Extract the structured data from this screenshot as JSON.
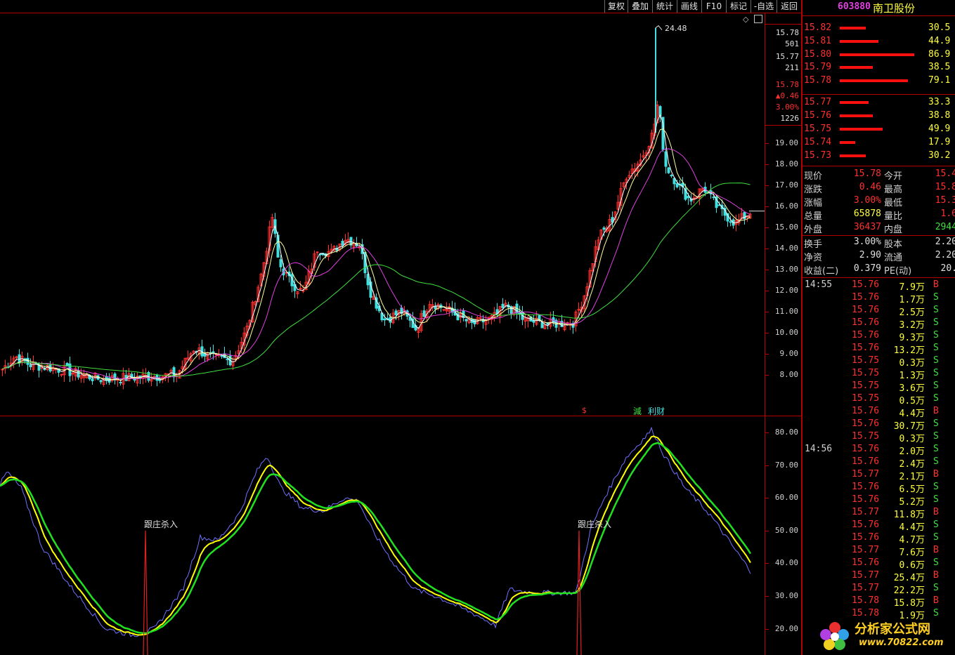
{
  "toolbar": {
    "buttons": [
      "复权",
      "叠加",
      "统计",
      "画线",
      "F10",
      "标记",
      "-自选",
      "返回"
    ]
  },
  "stock": {
    "code": "603880",
    "name": "南卫股份"
  },
  "price_axis": {
    "ticks": [
      "19.00",
      "18.00",
      "17.00",
      "16.00",
      "15.00",
      "14.00",
      "13.00",
      "12.00",
      "11.00",
      "10.00",
      "9.00",
      "8.00"
    ]
  },
  "mini_info": {
    "p1": "15.78",
    "v1": "501",
    "p2": "15.77",
    "v2": "211",
    "last": "15.78",
    "chg": "▲0.46",
    "pct": "3.00%",
    "vol": "1226"
  },
  "peak_label": "24.48",
  "markers": {
    "s": "$",
    "jian": "減",
    "cai": "利财"
  },
  "indicator_axis": {
    "ticks": [
      "80.00",
      "70.00",
      "60.00",
      "50.00",
      "40.00",
      "30.00",
      "20.00"
    ]
  },
  "signals": [
    {
      "label": "跟庄杀入"
    },
    {
      "label": "跟庄杀入"
    }
  ],
  "sell_orders": [
    {
      "price": "15.82",
      "vol": "30.5"
    },
    {
      "price": "15.81",
      "vol": "44.9"
    },
    {
      "price": "15.80",
      "vol": "86.9"
    },
    {
      "price": "15.79",
      "vol": "38.5"
    },
    {
      "price": "15.78",
      "vol": "79.1"
    }
  ],
  "buy_orders": [
    {
      "price": "15.77",
      "vol": "33.3"
    },
    {
      "price": "15.76",
      "vol": "38.8"
    },
    {
      "price": "15.75",
      "vol": "49.9"
    },
    {
      "price": "15.74",
      "vol": "17.9"
    },
    {
      "price": "15.73",
      "vol": "30.2"
    }
  ],
  "stats": [
    {
      "l1": "现价",
      "v1": "15.78",
      "l2": "今开",
      "v2": "15.4"
    },
    {
      "l1": "涨跌",
      "v1": "0.46",
      "l2": "最高",
      "v2": "15.8"
    },
    {
      "l1": "涨幅",
      "v1": "3.00%",
      "l2": "最低",
      "v2": "15.3"
    },
    {
      "l1": "总量",
      "v1": "65878",
      "l2": "量比",
      "v2": "1.6"
    },
    {
      "l1": "外盘",
      "v1": "36437",
      "l2": "内盘",
      "v2": "2944"
    }
  ],
  "stats2": [
    {
      "l1": "换手",
      "v1": "3.00%",
      "l2": "股本",
      "v2": "2.20"
    },
    {
      "l1": "净资",
      "v1": "2.90",
      "l2": "流通",
      "v2": "2.20"
    },
    {
      "l1": "收益(二)",
      "v1": "0.379",
      "l2": "PE(动)",
      "v2": "20."
    }
  ],
  "tick_groups": [
    {
      "time": "14:55",
      "rows": [
        {
          "price": "15.76",
          "vol": "7.9万",
          "side": "B"
        },
        {
          "price": "15.76",
          "vol": "1.7万",
          "side": "S"
        },
        {
          "price": "15.76",
          "vol": "2.5万",
          "side": "S"
        },
        {
          "price": "15.76",
          "vol": "3.2万",
          "side": "S"
        },
        {
          "price": "15.76",
          "vol": "9.3万",
          "side": "S"
        },
        {
          "price": "15.76",
          "vol": "13.2万",
          "side": "S"
        },
        {
          "price": "15.75",
          "vol": "0.3万",
          "side": "S"
        },
        {
          "price": "15.75",
          "vol": "1.3万",
          "side": "S"
        },
        {
          "price": "15.75",
          "vol": "3.6万",
          "side": "S"
        },
        {
          "price": "15.75",
          "vol": "0.5万",
          "side": "S"
        },
        {
          "price": "15.76",
          "vol": "4.4万",
          "side": "B"
        },
        {
          "price": "15.76",
          "vol": "30.7万",
          "side": "S"
        },
        {
          "price": "15.75",
          "vol": "0.3万",
          "side": "S"
        }
      ]
    },
    {
      "time": "14:56",
      "rows": [
        {
          "price": "15.76",
          "vol": "2.0万",
          "side": "S"
        },
        {
          "price": "15.76",
          "vol": "2.4万",
          "side": "S"
        },
        {
          "price": "15.77",
          "vol": "2.1万",
          "side": "B"
        },
        {
          "price": "15.76",
          "vol": "6.5万",
          "side": "S"
        },
        {
          "price": "15.76",
          "vol": "5.2万",
          "side": "S"
        },
        {
          "price": "15.77",
          "vol": "11.8万",
          "side": "B"
        },
        {
          "price": "15.76",
          "vol": "4.4万",
          "side": "S"
        },
        {
          "price": "15.76",
          "vol": "4.7万",
          "side": "S"
        },
        {
          "price": "15.77",
          "vol": "7.6万",
          "side": "B"
        },
        {
          "price": "15.76",
          "vol": "0.6万",
          "side": "S"
        },
        {
          "price": "15.77",
          "vol": "25.4万",
          "side": "B"
        },
        {
          "price": "15.77",
          "vol": "22.2万",
          "side": "S"
        },
        {
          "price": "15.78",
          "vol": "15.8万",
          "side": "B"
        },
        {
          "price": "15.78",
          "vol": "1.9万",
          "side": "S"
        }
      ]
    }
  ],
  "logo": {
    "title": "分析家公式网",
    "url": "www.70822.com"
  },
  "colors": {
    "up": "#ff3030",
    "down": "#40e0e0",
    "bg": "#000000",
    "frame": "#b40000",
    "ma5": "#ffffff",
    "ma10": "#ffffa0",
    "ma20": "#e040e0",
    "ma60": "#40e040",
    "k": "#7070ff",
    "d": "#ffff00",
    "j": "#20e020"
  }
}
